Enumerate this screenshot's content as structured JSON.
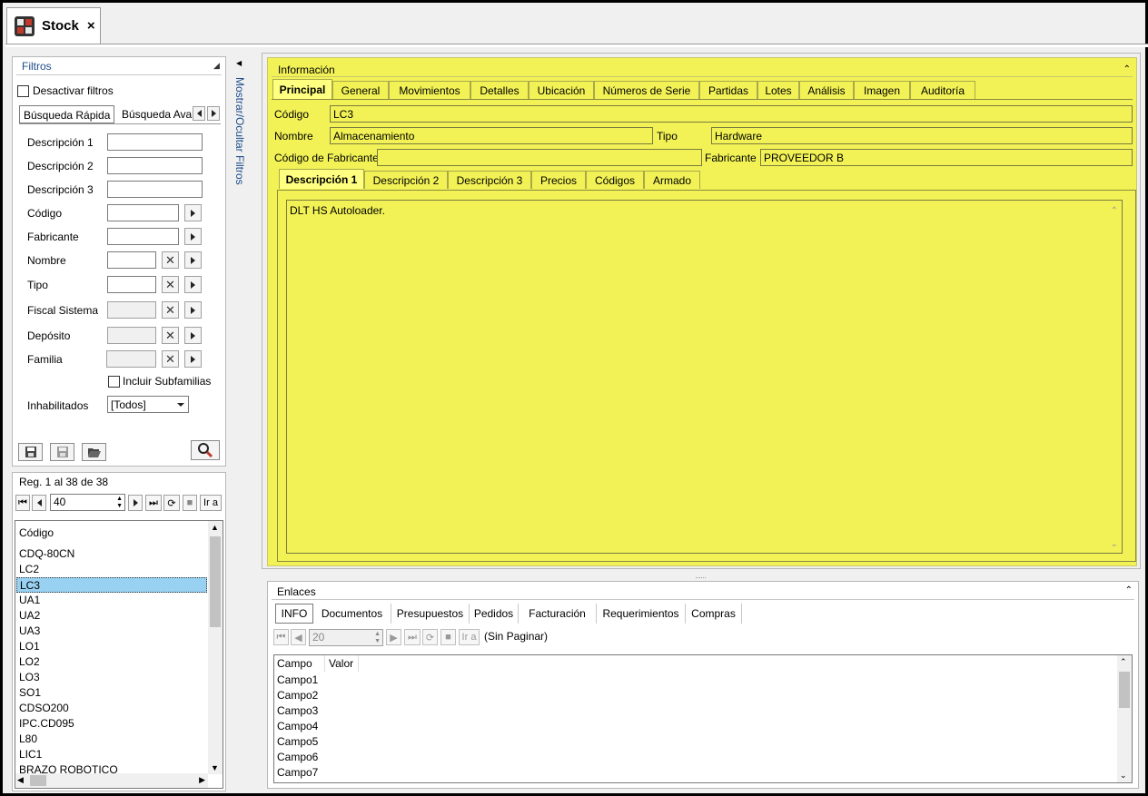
{
  "doc_tab": {
    "title": "Stock",
    "close": "×",
    "icon": "boxes-icon"
  },
  "filters": {
    "title": "Filtros",
    "disable_filters": "Desactivar filtros",
    "tabs": [
      "Búsqueda Rápida",
      "Búsqueda Avan:"
    ],
    "fields": [
      {
        "label": "Descripción 1"
      },
      {
        "label": "Descripción 2"
      },
      {
        "label": "Descripción 3"
      },
      {
        "label": "Código"
      },
      {
        "label": "Fabricante"
      },
      {
        "label": "Nombre"
      },
      {
        "label": "Tipo"
      },
      {
        "label": "Fiscal Sistema"
      },
      {
        "label": "Depósito"
      },
      {
        "label": "Familia"
      }
    ],
    "include_subfamilies": "Incluir Subfamilias",
    "disabled_label": "Inhabilitados",
    "disabled_value": "[Todos]"
  },
  "results": {
    "count": "Reg. 1 al 38 de 38",
    "page_size": "40",
    "goto_label": "Ir a",
    "column": "Código",
    "items": [
      "CDQ-80CN",
      "LC2",
      "LC3",
      "UA1",
      "UA2",
      "UA3",
      "LO1",
      "LO2",
      "LO3",
      "SO1",
      "CDSO200",
      "IPC.CD095",
      "L80",
      "LIC1",
      "BRAZO ROBOTICO"
    ],
    "selected": "LC3"
  },
  "toggle_label": "Mostrar/Ocultar Filtros",
  "info": {
    "title": "Información",
    "tabs": [
      "Principal",
      "General",
      "Movimientos",
      "Detalles",
      "Ubicación",
      "Números de Serie",
      "Partidas",
      "Lotes",
      "Análisis",
      "Imagen",
      "Auditoría"
    ],
    "codigo_label": "Código",
    "codigo": "LC3",
    "nombre_label": "Nombre",
    "nombre": "Almacenamiento",
    "tipo_label": "Tipo",
    "tipo": "Hardware",
    "cod_fab_label": "Código de Fabricante",
    "cod_fab": "",
    "fabricante_label": "Fabricante",
    "fabricante": "PROVEEDOR B",
    "sub_tabs": [
      "Descripción 1",
      "Descripción 2",
      "Descripción 3",
      "Precios",
      "Códigos",
      "Armado"
    ],
    "description": "DLT HS Autoloader."
  },
  "links": {
    "title": "Enlaces",
    "tabs": [
      "INFO",
      "Documentos",
      "Presupuestos",
      "Pedidos",
      "Facturación",
      "Requerimientos",
      "Compras"
    ],
    "page_size": "20",
    "goto_label": "Ir a",
    "paging_note": "(Sin Paginar)",
    "columns": [
      "Campo",
      "Valor"
    ],
    "rows": [
      "Campo1",
      "Campo2",
      "Campo3",
      "Campo4",
      "Campo5",
      "Campo6",
      "Campo7"
    ]
  },
  "colors": {
    "info_bg": "#f2f257",
    "selection": "#99d1f2",
    "panel_title": "#1f4d8c"
  }
}
